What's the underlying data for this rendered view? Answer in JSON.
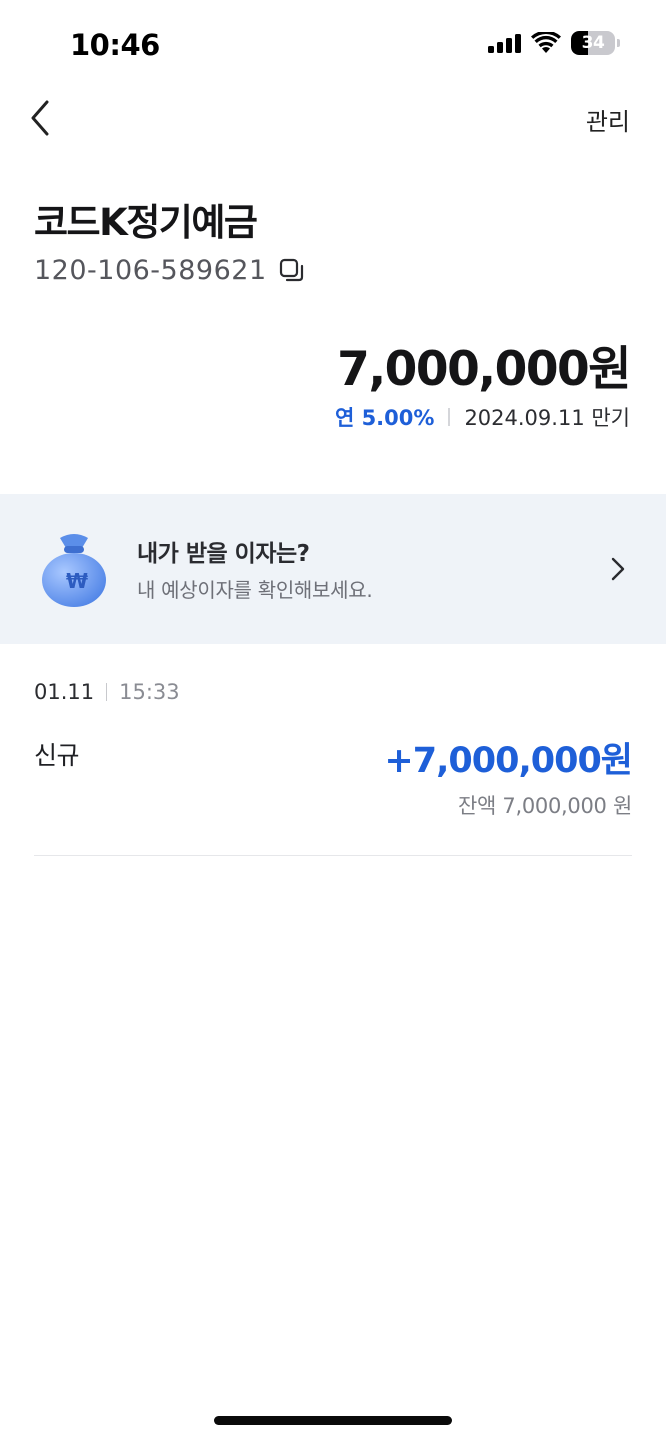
{
  "status_bar": {
    "time": "10:46",
    "battery": "34"
  },
  "nav": {
    "back_icon": "chevron-left-icon",
    "manage_label": "관리"
  },
  "account": {
    "title": "코드K정기예금",
    "number": "120-106-589621",
    "balance": "7,000,000원",
    "rate": "연 5.00%",
    "maturity": "2024.09.11 만기"
  },
  "banner": {
    "icon": "money-bag-icon",
    "title": "내가 받을 이자는?",
    "subtitle": "내 예상이자를 확인해보세요."
  },
  "transactions": [
    {
      "date": "01.11",
      "time": "15:33",
      "type": "신규",
      "amount": "+7,000,000원",
      "balance": "잔액 7,000,000 원"
    }
  ],
  "colors": {
    "accent": "#1e5fd8",
    "banner_bg": "#eff3f8"
  }
}
